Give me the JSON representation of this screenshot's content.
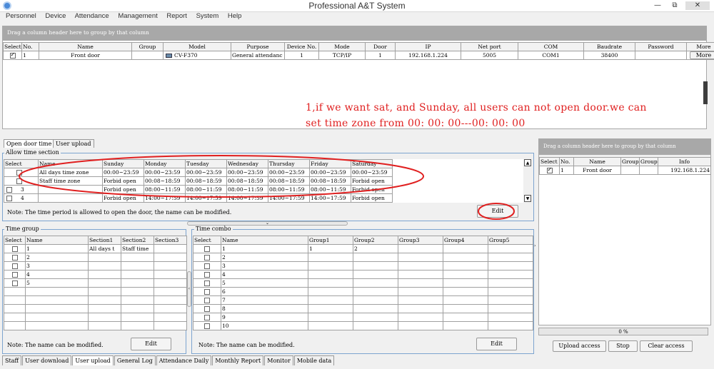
{
  "window": {
    "title": "Professional A&T System",
    "minimize": "—",
    "restore": "⧉",
    "close": "✕"
  },
  "menu": [
    "Personnel",
    "Device",
    "Attendance",
    "Management",
    "Report",
    "System",
    "Help"
  ],
  "device_grid": {
    "group_hint": "Drag a column header here to group by that column",
    "columns": [
      "Select",
      "No.",
      "Name",
      "Group",
      "Model",
      "Purpose",
      "Device No.",
      "Mode",
      "Door",
      "IP",
      "Net port",
      "COM",
      "Baudrate",
      "Password",
      "More"
    ],
    "row": {
      "checked": true,
      "no": "1",
      "name": "Front door",
      "group": "",
      "model": "CV-F370",
      "purpose": "General attendanc",
      "device_no": "1",
      "mode": "TCP/IP",
      "door": "1",
      "ip": "192.168.1.224",
      "net_port": "5005",
      "com": "COM1",
      "baudrate": "38400",
      "password": "",
      "more": "More"
    }
  },
  "annotation": {
    "line1": "1,if we want sat, and Sunday, all users can not open door.we can",
    "line2": "set time zone from 00: 00: 00---00: 00: 00"
  },
  "tabs": {
    "open_door_time": "Open door time",
    "user_upload": "User upload"
  },
  "allow_time": {
    "legend": "Allow time section",
    "columns": [
      "Select",
      "Name",
      "Sunday",
      "Monday",
      "Tuesday",
      "Wednesday",
      "Thursday",
      "Friday",
      "Saturday"
    ],
    "rows": [
      {
        "no": "",
        "name": "All days time zone",
        "days": [
          "00:00~23:59",
          "00:00~23:59",
          "00:00~23:59",
          "00:00~23:59",
          "00:00~23:59",
          "00:00~23:59",
          "00:00~23:59"
        ]
      },
      {
        "no": "",
        "name": "Staff time zone",
        "days": [
          "Forbid open",
          "00:08~18:59",
          "00:08~18:59",
          "00:08~18:59",
          "00:08~18:59",
          "00:08~18:59",
          "Forbid open"
        ]
      },
      {
        "no": "3",
        "name": "",
        "days": [
          "Forbid open",
          "08:00~11:59",
          "08:00~11:59",
          "08:00~11:59",
          "08:00~11:59",
          "08:00~11:59",
          "Forbid open"
        ]
      },
      {
        "no": "4",
        "name": "",
        "days": [
          "Forbid open",
          "14:00~17:59",
          "14:00~17:59",
          "14:00~17:59",
          "14:00~17:59",
          "14:00~17:59",
          "Forbid open"
        ]
      }
    ],
    "note": "Note: The time period is allowed to open the door, the name can be modified.",
    "edit": "Edit"
  },
  "time_group": {
    "legend": "Time group",
    "columns": [
      "Select",
      "Name",
      "Section1",
      "Section2",
      "Section3"
    ],
    "rows": [
      {
        "name": "1",
        "s1": "All days t",
        "s2": "Staff time",
        "s3": ""
      },
      {
        "name": "2",
        "s1": "",
        "s2": "",
        "s3": ""
      },
      {
        "name": "3",
        "s1": "",
        "s2": "",
        "s3": ""
      },
      {
        "name": "4",
        "s1": "",
        "s2": "",
        "s3": ""
      },
      {
        "name": "5",
        "s1": "",
        "s2": "",
        "s3": ""
      }
    ],
    "note": "Note: The name can be modified.",
    "edit": "Edit"
  },
  "time_combo": {
    "legend": "Time combo",
    "columns": [
      "Select",
      "Name",
      "Group1",
      "Group2",
      "Group3",
      "Group4",
      "Group5"
    ],
    "rows": [
      {
        "name": "1",
        "g1": "1",
        "g2": "2"
      },
      {
        "name": "2",
        "g1": "",
        "g2": ""
      },
      {
        "name": "3",
        "g1": "",
        "g2": ""
      },
      {
        "name": "4",
        "g1": "",
        "g2": ""
      },
      {
        "name": "5",
        "g1": "",
        "g2": ""
      },
      {
        "name": "6",
        "g1": "",
        "g2": ""
      },
      {
        "name": "7",
        "g1": "",
        "g2": ""
      },
      {
        "name": "8",
        "g1": "",
        "g2": ""
      },
      {
        "name": "9",
        "g1": "",
        "g2": ""
      },
      {
        "name": "10",
        "g1": "",
        "g2": ""
      }
    ],
    "note": "Note: The name can be modified.",
    "edit": "Edit"
  },
  "right_panel": {
    "group_hint": "Drag a column header here to group by that column",
    "columns": [
      "Select",
      "No.",
      "Name",
      "Group",
      "Group",
      "Info"
    ],
    "row": {
      "checked": true,
      "no": "1",
      "name": "Front door",
      "group1": "",
      "group2": "",
      "info": "192.168.1.224"
    },
    "progress": 0,
    "progress_label": "0 %",
    "upload_access": "Upload access",
    "stop": "Stop",
    "clear_access": "Clear access"
  },
  "bottom_tabs": [
    "Staff",
    "User download",
    "User upload",
    "General Log",
    "Attendance Daily",
    "Monthly Report",
    "Monitor",
    "Mobile data"
  ],
  "bottom_active": "User upload",
  "colors": {
    "annotation": "#e02020",
    "highlight_ellipse": "#e02020",
    "group_bar": "#a8a8a8",
    "fieldset_border": "#7da4cf"
  }
}
